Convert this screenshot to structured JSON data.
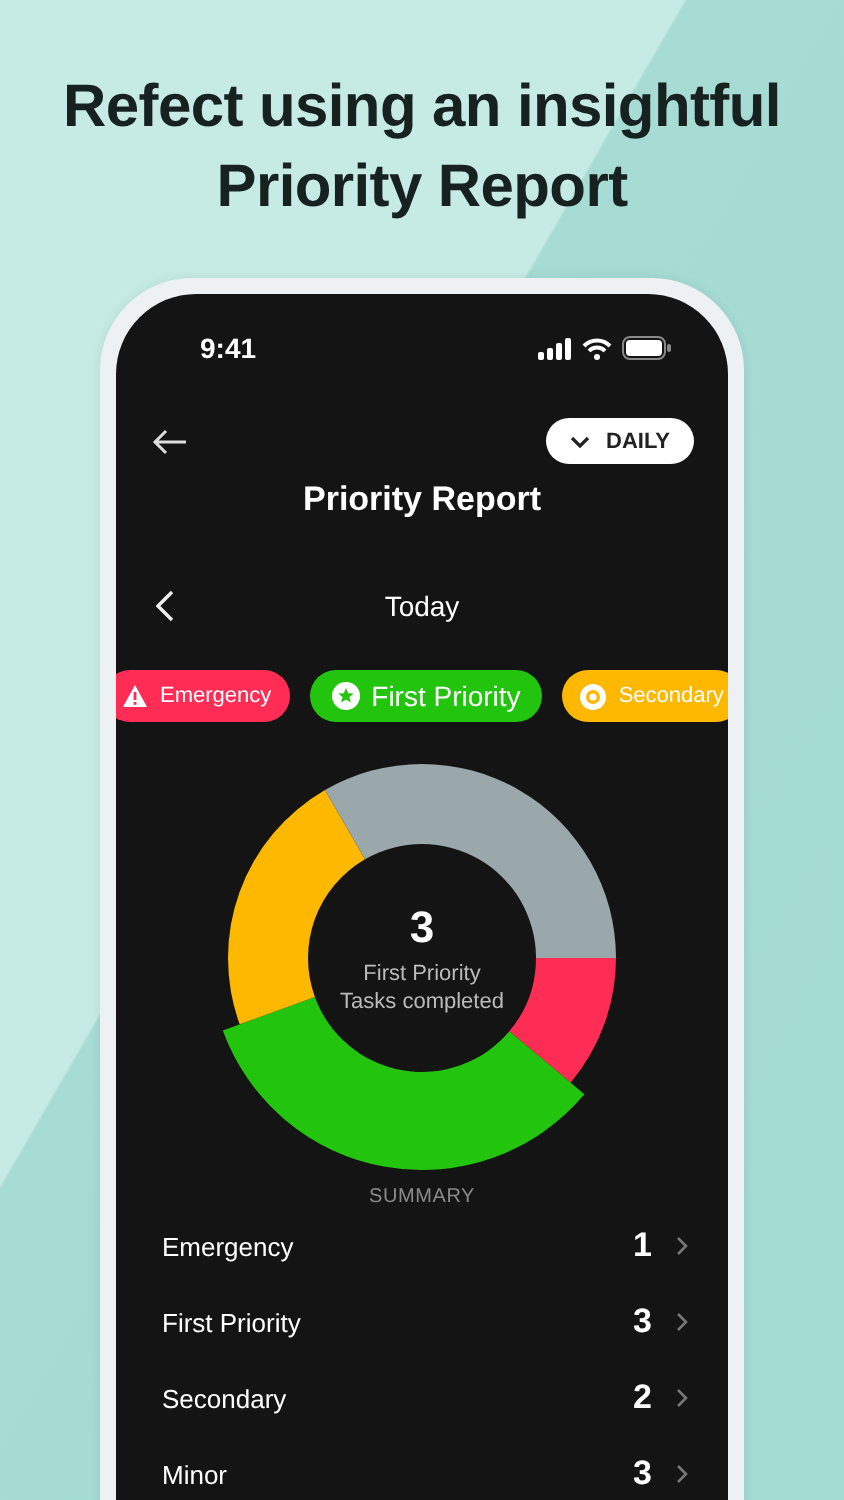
{
  "headline": "Refect using an insightful Priority Report",
  "status_bar": {
    "time": "9:41"
  },
  "period_button": {
    "label": "DAILY"
  },
  "title": "Priority Report",
  "date_nav": {
    "label": "Today"
  },
  "filters": [
    {
      "label": "Emergency",
      "kind": "alert",
      "color": "#ff2d55",
      "selected": false
    },
    {
      "label": "First Priority",
      "kind": "star",
      "color": "#22c40e",
      "selected": true
    },
    {
      "label": "Secondary",
      "kind": "ring",
      "color": "#ffb800",
      "selected": false
    }
  ],
  "chart": {
    "count": "3",
    "caption_1": "First Priority",
    "caption_2": "Tasks completed"
  },
  "summary": {
    "heading": "SUMMARY",
    "rows": [
      {
        "name": "Emergency",
        "count": "1"
      },
      {
        "name": "First Priority",
        "count": "3"
      },
      {
        "name": "Secondary",
        "count": "2"
      },
      {
        "name": "Minor",
        "count": "3"
      }
    ]
  }
}
